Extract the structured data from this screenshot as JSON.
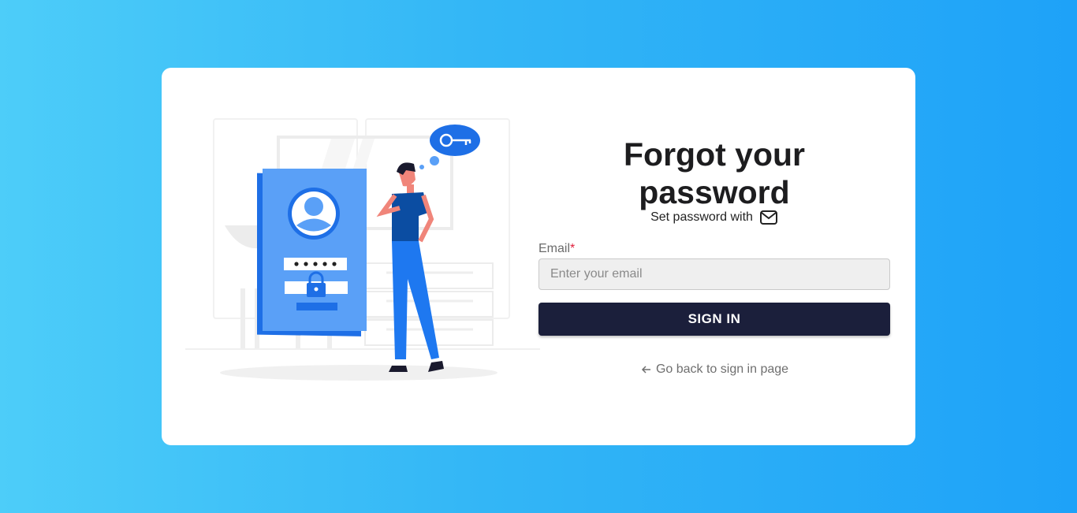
{
  "page": {
    "title_line1": "Forgot your",
    "title_line2": "password",
    "subtitle": "Set password with",
    "subtitle_icon": "mail-icon"
  },
  "form": {
    "email_label": "Email",
    "required_mark": "*",
    "email_placeholder": "Enter your email",
    "email_value": "",
    "submit_label": "SIGN IN",
    "back_link_label": "Go back to sign in page",
    "back_icon": "arrow-left-icon"
  },
  "colors": {
    "background_start": "#4dcdf9",
    "background_end": "#1ea2f8",
    "card": "#ffffff",
    "button": "#1b1f3b",
    "illustration_blue": "#3b82f6",
    "required": "#e0203c"
  }
}
